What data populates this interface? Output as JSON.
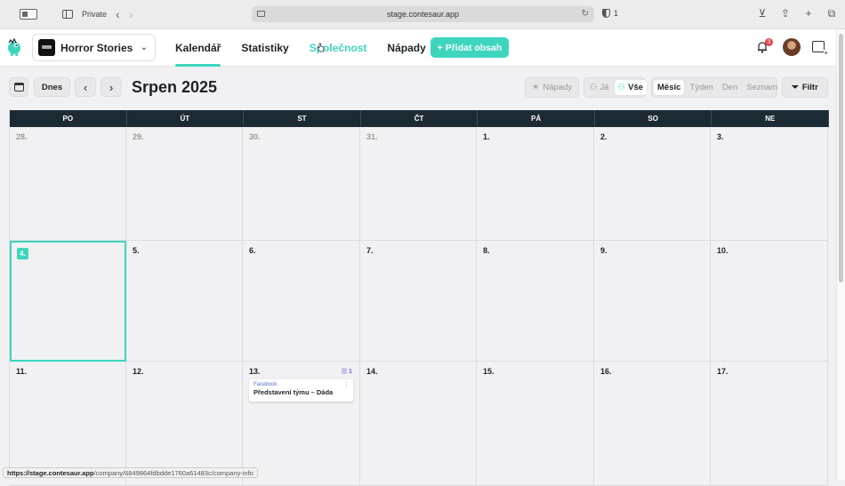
{
  "browser": {
    "private_label": "Private",
    "url": "stage.contesaur.app",
    "shield_count": "1",
    "status_url_host": "https://stage.contesaur.app",
    "status_url_path": "/company/6849864fdbdde1760a61483c/company-info"
  },
  "header": {
    "project_name": "Horror Stories",
    "nav": [
      {
        "label": "Kalendář",
        "active": true
      },
      {
        "label": "Statistiky",
        "active": false
      },
      {
        "label": "Společnost",
        "active": false
      },
      {
        "label": "Nápady",
        "active": false
      }
    ],
    "add_button": "+ Přidat obsah",
    "notification_count": "3"
  },
  "toolbar": {
    "today": "Dnes",
    "prev": "‹",
    "next": "›",
    "title": "Srpen 2025",
    "ideas": "Nápady",
    "owner_me": "Já",
    "owner_all": "Vše",
    "view_month": "Měsíc",
    "view_week": "Týden",
    "view_day": "Den",
    "view_list": "Seznam",
    "filter": "Filtr"
  },
  "calendar": {
    "weekdays": [
      "PO",
      "ÚT",
      "ST",
      "ČT",
      "PÁ",
      "SO",
      "NE"
    ],
    "weeks": [
      [
        {
          "day": "28.",
          "other": true
        },
        {
          "day": "29.",
          "other": true
        },
        {
          "day": "30.",
          "other": true
        },
        {
          "day": "31.",
          "other": true
        },
        {
          "day": "1.",
          "other": false
        },
        {
          "day": "2.",
          "other": false
        },
        {
          "day": "3.",
          "other": false
        }
      ],
      [
        {
          "day": "4.",
          "other": false,
          "today": true
        },
        {
          "day": "5.",
          "other": false
        },
        {
          "day": "6.",
          "other": false
        },
        {
          "day": "7.",
          "other": false
        },
        {
          "day": "8.",
          "other": false
        },
        {
          "day": "9.",
          "other": false
        },
        {
          "day": "10.",
          "other": false
        }
      ],
      [
        {
          "day": "11.",
          "other": false
        },
        {
          "day": "12.",
          "other": false
        },
        {
          "day": "13.",
          "other": false,
          "count": "1",
          "event": {
            "channel": "Facebook",
            "title": "Představení týmu – Dáda"
          }
        },
        {
          "day": "14.",
          "other": false
        },
        {
          "day": "15.",
          "other": false
        },
        {
          "day": "16.",
          "other": false
        },
        {
          "day": "17.",
          "other": false
        }
      ]
    ]
  },
  "colors": {
    "accent": "#3dd6bd",
    "header_dark": "#1c2b33",
    "badge": "#e8464d"
  }
}
